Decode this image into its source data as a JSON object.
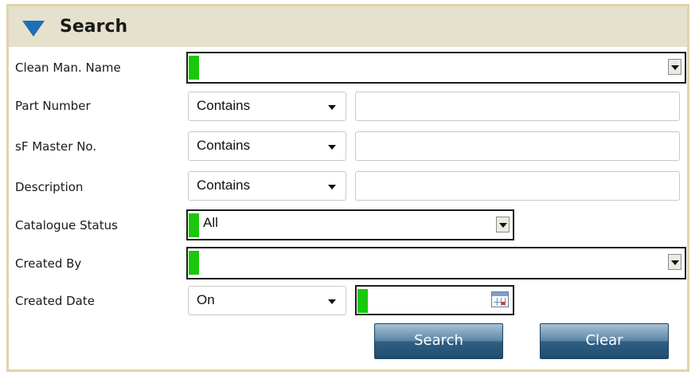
{
  "panel": {
    "title": "Search"
  },
  "fields": {
    "clean_man_name": {
      "label": "Clean Man. Name",
      "value": ""
    },
    "part_number": {
      "label": "Part Number",
      "operator": "Contains",
      "value": ""
    },
    "sf_master_no": {
      "label": "sF Master No.",
      "operator": "Contains",
      "value": ""
    },
    "description": {
      "label": "Description",
      "operator": "Contains",
      "value": ""
    },
    "catalogue_status": {
      "label": "Catalogue Status",
      "value": "All"
    },
    "created_by": {
      "label": "Created By",
      "value": ""
    },
    "created_date": {
      "label": "Created Date",
      "operator": "On",
      "value": ""
    }
  },
  "buttons": {
    "search": "Search",
    "clear": "Clear"
  },
  "colors": {
    "header_bg": "#e6e1cd",
    "accent": "#1b70b8",
    "required_marker": "#19c70b",
    "button": "#2f5f83"
  },
  "icons": {
    "collapse": "triangle-down-icon",
    "calendar": "calendar-icon"
  }
}
